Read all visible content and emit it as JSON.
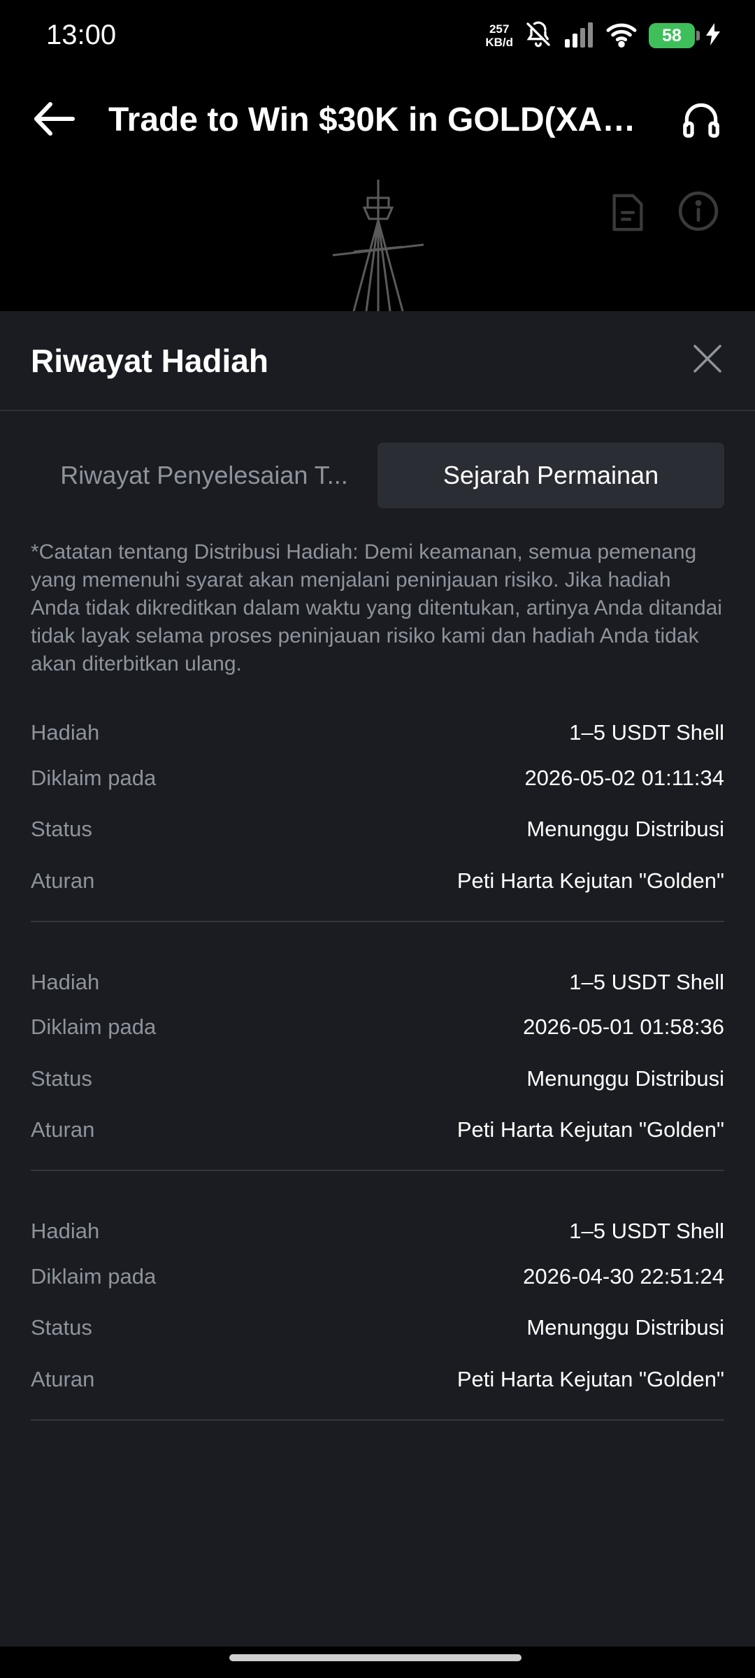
{
  "status_bar": {
    "time": "13:00",
    "net_speed_value": "257",
    "net_speed_unit": "KB/d",
    "battery": "58",
    "icons": [
      "bell-off-icon",
      "signal-icon",
      "wifi-icon",
      "battery-icon",
      "charging-icon"
    ]
  },
  "header": {
    "title": "Trade to Win $30K in GOLD(XA…",
    "back_icon": "arrow-left-icon",
    "support_icon": "headset-icon"
  },
  "hero": {
    "icons": [
      "document-icon",
      "info-icon"
    ]
  },
  "sheet": {
    "title": "Riwayat Hadiah",
    "close_icon": "close-icon",
    "tabs": [
      {
        "label": "Riwayat Penyelesaian T...",
        "active": false
      },
      {
        "label": "Sejarah Permainan",
        "active": true
      }
    ],
    "note": "*Catatan tentang Distribusi Hadiah: Demi keamanan, semua pemenang yang memenuhi syarat akan menjalani peninjauan risiko. Jika hadiah Anda tidak dikreditkan dalam waktu yang ditentukan, artinya Anda ditandai tidak layak selama proses peninjauan risiko kami dan hadiah Anda tidak akan diterbitkan ulang.",
    "labels": {
      "reward": "Hadiah",
      "claimed_at": "Diklaim pada",
      "status": "Status",
      "rule": "Aturan"
    },
    "records": [
      {
        "reward": "1–5 USDT Shell",
        "claimed_at": "2026-05-02 01:11:34",
        "status": "Menunggu Distribusi",
        "rule": "Peti Harta Kejutan \"Golden\""
      },
      {
        "reward": "1–5 USDT Shell",
        "claimed_at": "2026-05-01 01:58:36",
        "status": "Menunggu Distribusi",
        "rule": "Peti Harta Kejutan \"Golden\""
      },
      {
        "reward": "1–5 USDT Shell",
        "claimed_at": "2026-04-30 22:51:24",
        "status": "Menunggu Distribusi",
        "rule": "Peti Harta Kejutan \"Golden\""
      }
    ]
  },
  "colors": {
    "background": "#000000",
    "sheet": "#1a1c21",
    "active_tab": "#2a2d34",
    "muted_text": "#8e939c",
    "battery": "#3fbf5a"
  }
}
